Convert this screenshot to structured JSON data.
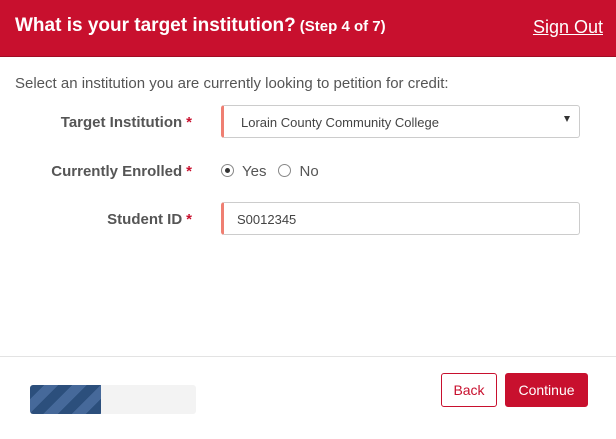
{
  "header": {
    "title": "What is your target institution?",
    "step": "(Step 4 of 7)",
    "sign_out": "Sign Out",
    "color": "#c8102e"
  },
  "form": {
    "intro": "Select an institution you are currently looking to petition for credit:",
    "required_marker": "*",
    "target_institution": {
      "label": "Target Institution",
      "value": "Lorain County Community College"
    },
    "currently_enrolled": {
      "label": "Currently Enrolled",
      "options": [
        "Yes",
        "No"
      ],
      "selected": "Yes"
    },
    "student_id": {
      "label": "Student ID",
      "value": "S0012345"
    }
  },
  "footer": {
    "progress_fraction": 0.43,
    "back_label": "Back",
    "continue_label": "Continue"
  }
}
